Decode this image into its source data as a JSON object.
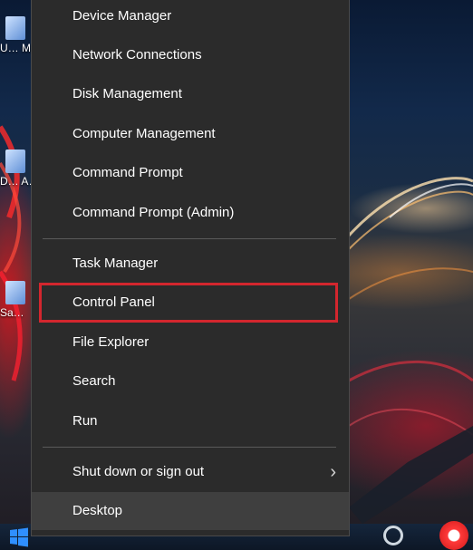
{
  "desktop": {
    "icons": [
      {
        "caption": "U… Ma…",
        "icon": "user-folder-icon"
      },
      {
        "caption": "D… A…",
        "icon": "app-shortcut-icon"
      },
      {
        "caption": "Sa…",
        "icon": "save-icon"
      }
    ]
  },
  "menu": {
    "items": [
      {
        "label": "Device Manager"
      },
      {
        "label": "Network Connections"
      },
      {
        "label": "Disk Management"
      },
      {
        "label": "Computer Management"
      },
      {
        "label": "Command Prompt"
      },
      {
        "label": "Command Prompt (Admin)"
      },
      {
        "label": "Task Manager"
      },
      {
        "label": "Control Panel"
      },
      {
        "label": "File Explorer"
      },
      {
        "label": "Search"
      },
      {
        "label": "Run"
      },
      {
        "label": "Shut down or sign out",
        "has_submenu": true,
        "submenu_icon": "chevron-right-icon"
      },
      {
        "label": "Desktop",
        "hovered": true
      }
    ],
    "highlighted_item": "Control Panel",
    "highlight_color": "#d3262e"
  },
  "taskbar": {
    "start_icon": "windows-logo-icon",
    "tray_icons": [
      "cortana-circle-icon",
      "red-app-icon"
    ]
  },
  "colors": {
    "menu_bg": "#2b2b2b",
    "menu_text": "#ffffff",
    "hover_bg": "#3f3f3f",
    "accent": "#1e90ff"
  }
}
